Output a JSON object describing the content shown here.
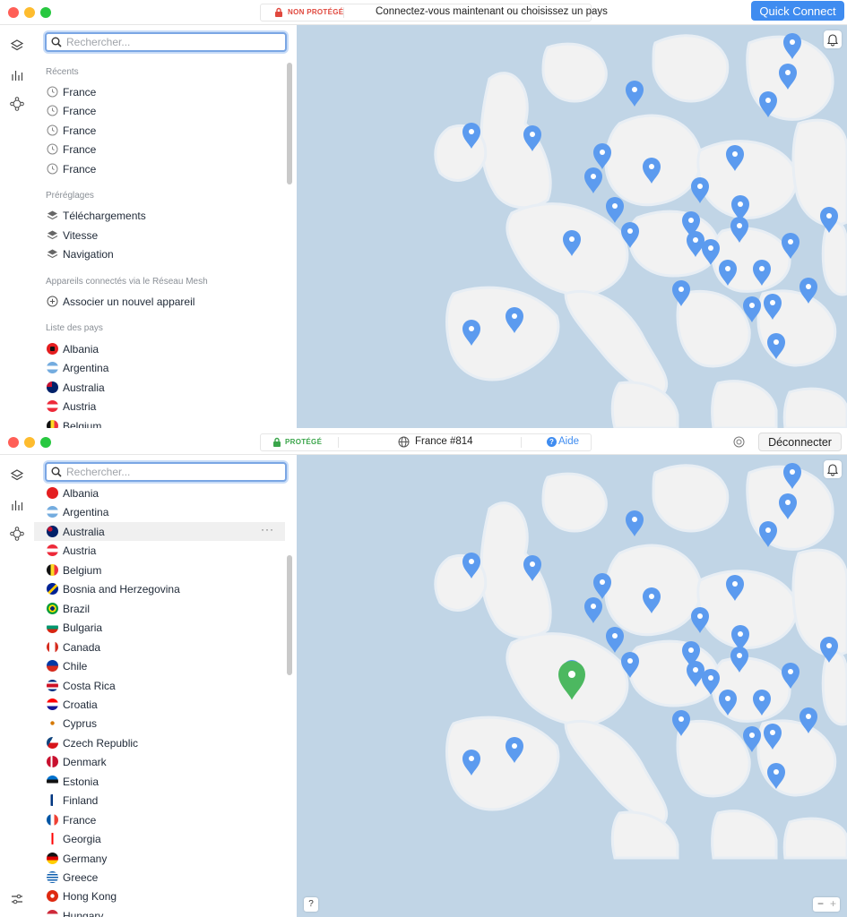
{
  "window1": {
    "status": "NON PROTÉGÉ",
    "status_message": "Connectez-vous maintenant ou choisissez un pays",
    "quick_connect": "Quick Connect",
    "search_placeholder": "Rechercher...",
    "recents_header": "Récents",
    "recents": [
      "France",
      "France",
      "France",
      "France",
      "France"
    ],
    "presets_header": "Préréglages",
    "presets": [
      "Téléchargements",
      "Vitesse",
      "Navigation"
    ],
    "mesh_header": "Appareils connectés via le Réseau Mesh",
    "mesh_action": "Associer un nouvel appareil",
    "countries_header": "Liste des pays",
    "countries": [
      "Albania",
      "Argentina",
      "Australia",
      "Austria",
      "Belgium"
    ]
  },
  "window2": {
    "status": "PROTÉGÉ",
    "server": "France #814",
    "help": "Aide",
    "disconnect": "Déconnecter",
    "search_placeholder": "Rechercher...",
    "countries": [
      "Albania",
      "Argentina",
      "Australia",
      "Austria",
      "Belgium",
      "Bosnia and Herzegovina",
      "Brazil",
      "Bulgaria",
      "Canada",
      "Chile",
      "Costa Rica",
      "Croatia",
      "Cyprus",
      "Czech Republic",
      "Denmark",
      "Estonia",
      "Finland",
      "France",
      "Georgia",
      "Germany",
      "Greece",
      "Hong Kong",
      "Hungary"
    ],
    "hovered_country": "Australia",
    "more_menu": "···",
    "help_button": "?",
    "zoom_controls": "− +"
  },
  "colors": {
    "accent": "#3f8cf0",
    "unprotected": "#e0483e",
    "protected": "#3aa54a",
    "pin": "#5c9bef",
    "pin_connected": "#4cb860",
    "water": "#c1d5e6",
    "land": "#f2f2f2"
  },
  "icons": {
    "rail": [
      "layers-icon",
      "stats-icon",
      "mesh-icon"
    ],
    "recent": "clock-icon",
    "preset": "layers-icon",
    "mesh": "plus-circle-icon",
    "status": "lock-icon",
    "server": "globe-icon",
    "map": "bell-icon"
  }
}
